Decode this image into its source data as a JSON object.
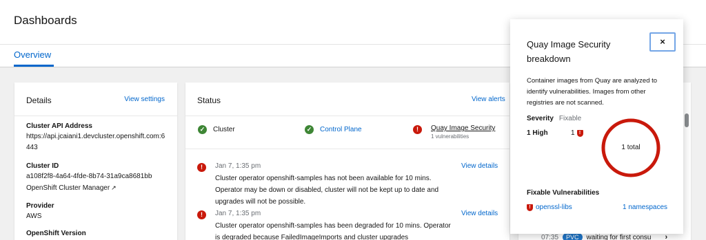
{
  "page": {
    "title": "Dashboards",
    "tabs": [
      {
        "label": "Overview",
        "active": true
      }
    ]
  },
  "details": {
    "title": "Details",
    "view_settings": "View settings",
    "items": [
      {
        "label": "Cluster API Address",
        "value": "https://api.jcaiani1.devcluster.openshift.com:6443"
      },
      {
        "label": "Cluster ID",
        "value": "a108f2f8-4a64-4fde-8b74-31a9ca8681bb",
        "link": "OpenShift Cluster Manager"
      },
      {
        "label": "Provider",
        "value": "AWS"
      },
      {
        "label": "OpenShift Version",
        "value": ""
      }
    ]
  },
  "status": {
    "title": "Status",
    "view_alerts": "View alerts",
    "health": [
      {
        "label": "Cluster",
        "state": "ok"
      },
      {
        "label": "Control Plane",
        "state": "ok"
      },
      {
        "label": "Quay Image Security",
        "state": "error",
        "sub": "1 vulnerabilities"
      }
    ],
    "alerts": [
      {
        "time": "Jan 7, 1:35 pm",
        "message": "Cluster operator openshift-samples has not been available for 10 mins. Operator may be down or disabled, cluster will not be kept up to date and upgrades will not be possible.",
        "action": "View details"
      },
      {
        "time": "Jan 7, 1:35 pm",
        "message": "Cluster operator openshift-samples has been degraded for 10 mins. Operator is degraded because FailedImageImports and cluster upgrades",
        "action": "View details"
      }
    ]
  },
  "activity": {
    "time": "07:35",
    "badge": "PVC",
    "text": "waiting for first consu"
  },
  "popover": {
    "title": "Quay Image Security breakdown",
    "close": "×",
    "description": "Container images from Quay are analyzed to identify vulnerabilities. Images from other registries are not scanned.",
    "severity_label": "Severity",
    "fixable_label": "Fixable",
    "severity_rows": [
      {
        "label": "1 High",
        "fixable": "1"
      }
    ],
    "donut_label": "1 total",
    "donut_fraction": 1.0,
    "fixable_title": "Fixable Vulnerabilities",
    "fixable_items": [
      {
        "name": "openssl-libs",
        "namespaces": "1 namespaces"
      }
    ]
  },
  "colors": {
    "link": "#0066cc",
    "ok": "#3e8635",
    "danger": "#c9190b"
  }
}
